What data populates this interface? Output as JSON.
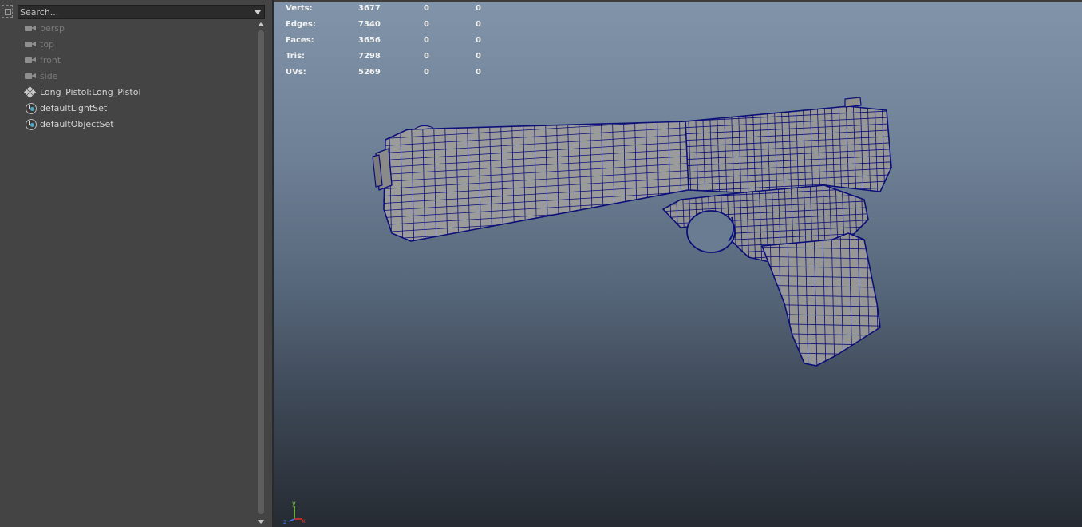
{
  "outliner": {
    "search": {
      "placeholder": "Search..."
    },
    "items": [
      {
        "label": "persp",
        "icon": "camera-icon",
        "dim": true
      },
      {
        "label": "top",
        "icon": "camera-icon",
        "dim": true
      },
      {
        "label": "front",
        "icon": "camera-icon",
        "dim": true
      },
      {
        "label": "side",
        "icon": "camera-icon",
        "dim": true
      },
      {
        "label": "Long_Pistol:Long_Pistol",
        "icon": "transform-group-icon",
        "dim": false
      },
      {
        "label": "defaultLightSet",
        "icon": "object-set-icon",
        "dim": false
      },
      {
        "label": "defaultObjectSet",
        "icon": "object-set-icon",
        "dim": false
      }
    ]
  },
  "viewport": {
    "heads_up_display": {
      "rows": [
        {
          "label": "Verts:",
          "values": [
            "3677",
            "0",
            "0"
          ]
        },
        {
          "label": "Edges:",
          "values": [
            "7340",
            "0",
            "0"
          ]
        },
        {
          "label": "Faces:",
          "values": [
            "3656",
            "0",
            "0"
          ]
        },
        {
          "label": "Tris:",
          "values": [
            "7298",
            "0",
            "0"
          ]
        },
        {
          "label": "UVs:",
          "values": [
            "5269",
            "0",
            "0"
          ]
        }
      ]
    },
    "axis_labels": {
      "x": "x",
      "y": "y",
      "z": "z"
    },
    "colors": {
      "wireframe": "#0b0f78",
      "mesh_fill": "#9a9a9a",
      "axis_x": "#e0322b",
      "axis_y": "#7fd33a",
      "axis_z": "#3f6ee8"
    }
  }
}
